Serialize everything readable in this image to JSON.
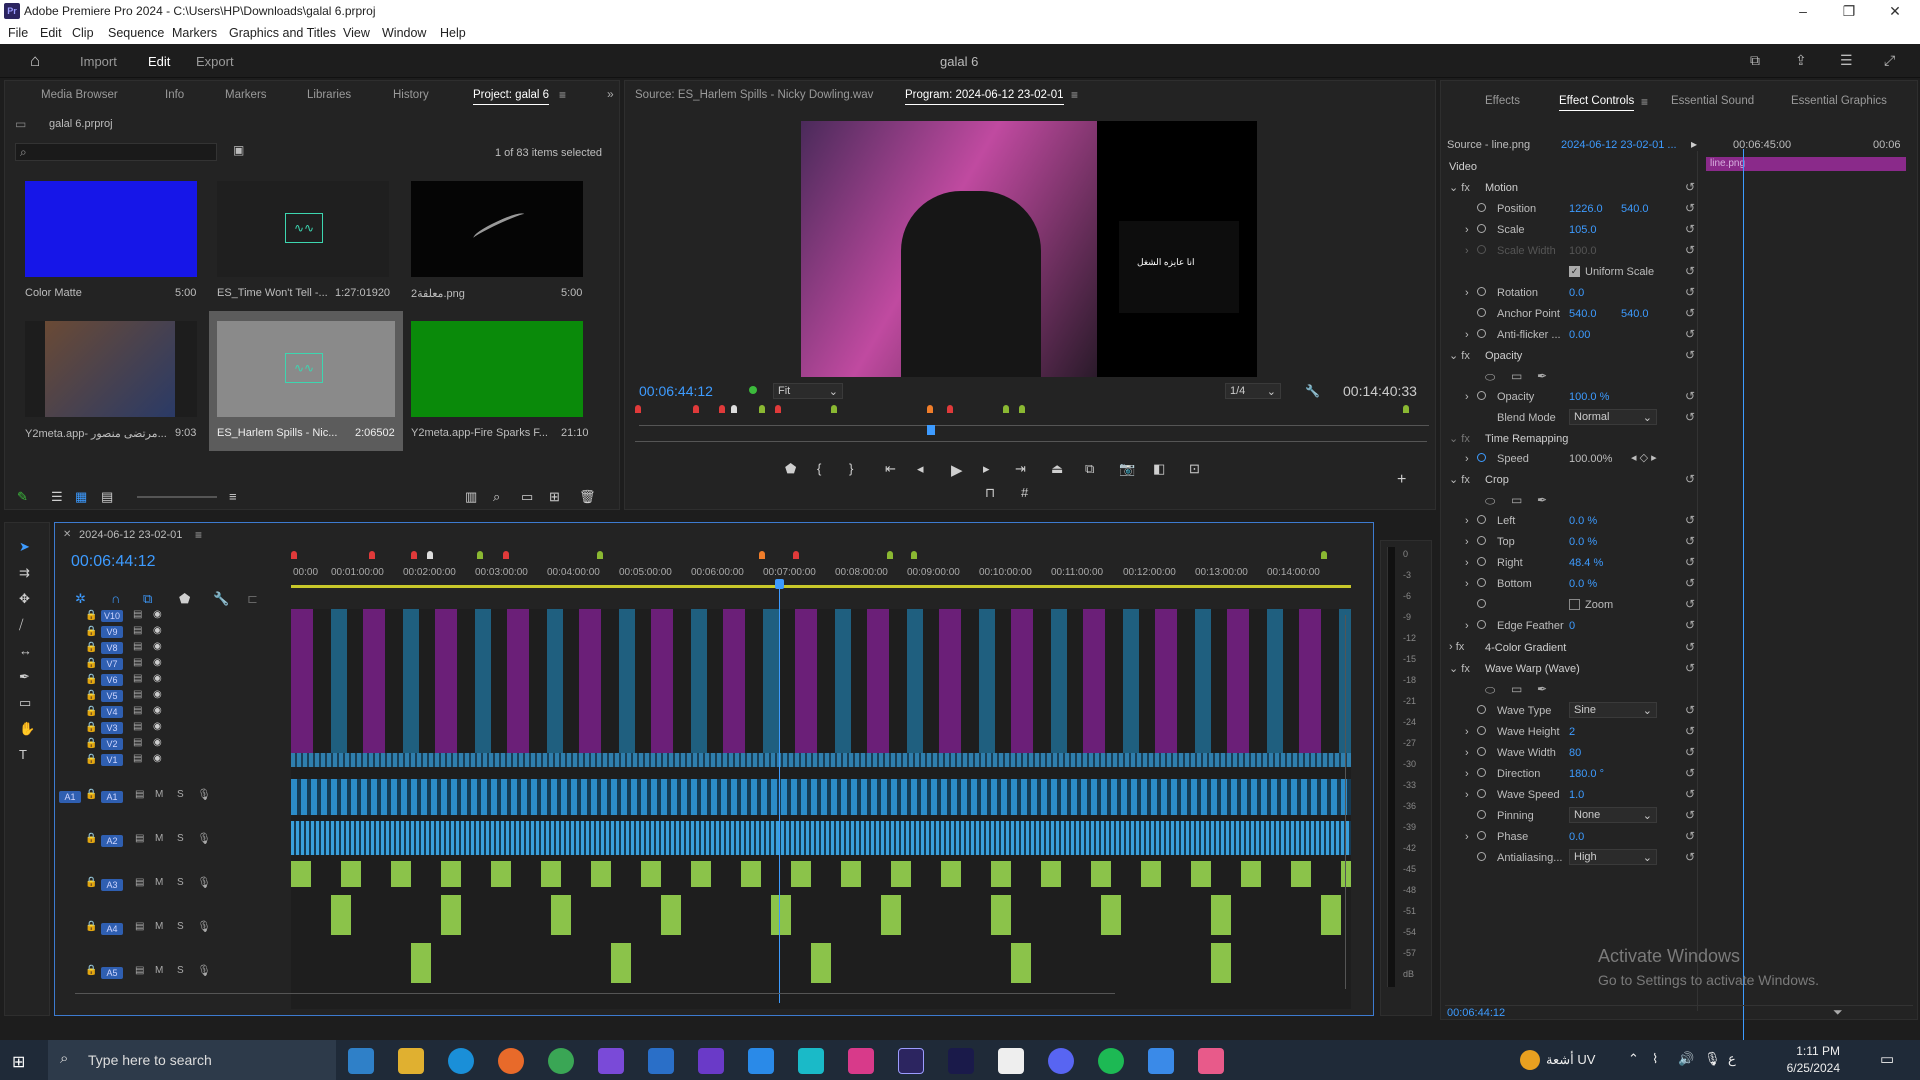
{
  "window": {
    "title": "Adobe Premiere Pro 2024 - C:\\Users\\HP\\Downloads\\galal 6.prproj",
    "minimize": "–",
    "restore": "❐",
    "close": "✕"
  },
  "menu": [
    "File",
    "Edit",
    "Clip",
    "Sequence",
    "Markers",
    "Graphics and Titles",
    "View",
    "Window",
    "Help"
  ],
  "header": {
    "import": "Import",
    "edit": "Edit",
    "export": "Export",
    "project_title": "galal 6"
  },
  "project": {
    "tabs": [
      "Media Browser",
      "Info",
      "Markers",
      "Libraries",
      "History",
      "Project: galal 6"
    ],
    "file": "galal 6.prproj",
    "selection": "1 of 83 items selected",
    "items": [
      {
        "name": "Color Matte",
        "duration": "5:00",
        "color": "#1616e8"
      },
      {
        "name": "ES_Time Won't Tell -...",
        "duration": "1:27:01920",
        "color": "#1f1f1f"
      },
      {
        "name": "معلقة2.png",
        "duration": "5:00",
        "color": "#050505"
      },
      {
        "name": "Y2meta.app- مرتضى منصور...",
        "duration": "9:03",
        "color": "#3a2a22"
      },
      {
        "name": "ES_Harlem Spills - Nic...",
        "duration": "2:06502",
        "color": "#8a8a8a"
      },
      {
        "name": "Y2meta.app-Fire Sparks  F...",
        "duration": "21:10",
        "color": "#0a8a0a"
      }
    ]
  },
  "source": {
    "tab": "Source: ES_Harlem Spills - Nicky Dowling.wav"
  },
  "program": {
    "tab": "Program: 2024-06-12 23-02-01",
    "timecode": "00:06:44:12",
    "fit": "Fit",
    "quality": "1/4",
    "duration": "00:14:40:33",
    "caption": "انا عايزه الشغل"
  },
  "sequence": {
    "name": "2024-06-12 23-02-01",
    "timecode": "00:06:44:12",
    "ruler": [
      "00:00",
      "00:01:00:00",
      "00:02:00:00",
      "00:03:00:00",
      "00:04:00:00",
      "00:05:00:00",
      "00:06:00:00",
      "00:07:00:00",
      "00:08:00:00",
      "00:09:00:00",
      "00:10:00:00",
      "00:11:00:00",
      "00:12:00:00",
      "00:13:00:00",
      "00:14:00:00"
    ],
    "video_tracks": [
      "V10",
      "V9",
      "V8",
      "V7",
      "V6",
      "V5",
      "V4",
      "V3",
      "V2",
      "V1"
    ],
    "audio_tracks": [
      "A1",
      "A2",
      "A3",
      "A4",
      "A5"
    ],
    "audio_src": "A1"
  },
  "meter": [
    "0",
    "-3",
    "-6",
    "-9",
    "-12",
    "-15",
    "-18",
    "-21",
    "-24",
    "-27",
    "-30",
    "-33",
    "-36",
    "-39",
    "-42",
    "-45",
    "-48",
    "-51",
    "-54",
    "-57",
    "dB"
  ],
  "effects_panel": {
    "tabs": [
      "Effects",
      "Effect Controls",
      "Essential Sound",
      "Essential Graphics"
    ],
    "source": "Source - line.png",
    "clip": "2024-06-12 23-02-01 ...",
    "mini_time": "00:06:45:00",
    "mini_time2": "00:06",
    "clip_name": "line.png",
    "video": "Video",
    "motion": "Motion",
    "position": "Position",
    "pos_x": "1226.0",
    "pos_y": "540.0",
    "scale": "Scale",
    "scale_v": "105.0",
    "scale_w": "Scale Width",
    "scale_w_v": "100.0",
    "uniform": "Uniform Scale",
    "rotation": "Rotation",
    "rotation_v": "0.0",
    "anchor": "Anchor Point",
    "anchor_x": "540.0",
    "anchor_y": "540.0",
    "antiflicker": "Anti-flicker ...",
    "antiflicker_v": "0.00",
    "opacity_h": "Opacity",
    "opacity": "Opacity",
    "opacity_v": "100.0 %",
    "blend": "Blend Mode",
    "blend_v": "Normal",
    "timeremap": "Time Remapping",
    "speed": "Speed",
    "speed_v": "100.00%",
    "crop": "Crop",
    "left": "Left",
    "left_v": "0.0 %",
    "top": "Top",
    "top_v": "0.0 %",
    "right": "Right",
    "right_v": "48.4 %",
    "bottom": "Bottom",
    "bottom_v": "0.0 %",
    "zoom": "Zoom",
    "edgefeather": "Edge Feather",
    "edgefeather_v": "0",
    "fourcolor": "4-Color Gradient",
    "wavewarp": "Wave Warp (Wave)",
    "wavetype": "Wave Type",
    "wavetype_v": "Sine",
    "waveheight": "Wave Height",
    "waveheight_v": "2",
    "wavewidth": "Wave Width",
    "wavewidth_v": "80",
    "direction": "Direction",
    "direction_v": "180.0 °",
    "wavespeed": "Wave Speed",
    "wavespeed_v": "1.0",
    "pinning": "Pinning",
    "pinning_v": "None",
    "phase": "Phase",
    "phase_v": "0.0",
    "antialias": "Antialiasing...",
    "antialias_v": "High",
    "timecode": "00:06:44:12"
  },
  "watermark": {
    "line1": "Activate Windows",
    "line2": "Go to Settings to activate Windows."
  },
  "taskbar": {
    "search": "Type here to search",
    "weather": "أشعة UV",
    "time": "1:11 PM",
    "date": "6/25/2024",
    "lang": "ع"
  }
}
